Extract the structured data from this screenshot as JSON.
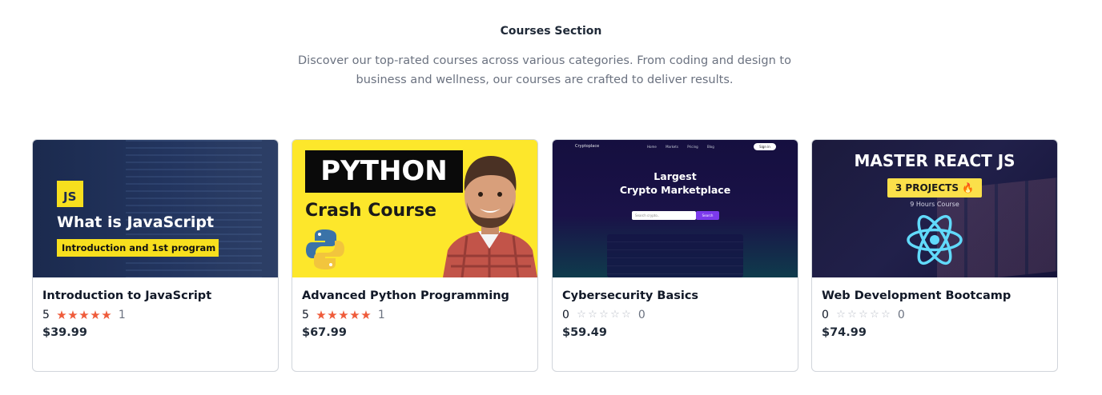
{
  "section": {
    "title": "Courses Section",
    "description": "Discover our top-rated courses across various categories. From coding and design to business and wellness, our courses are crafted to deliver results."
  },
  "colors": {
    "star_filled": "#ef5b3a",
    "star_empty": "#b9bec7",
    "card_border": "#d1d5db"
  },
  "courses": [
    {
      "title": "Introduction to JavaScript",
      "rating": "5",
      "stars_filled": 5,
      "rating_count": "1",
      "price": "$39.99",
      "thumb": {
        "badge": "JS",
        "headline": "What is JavaScript",
        "sub": "Introduction and 1st program"
      }
    },
    {
      "title": "Advanced Python Programming",
      "rating": "5",
      "stars_filled": 5,
      "rating_count": "1",
      "price": "$67.99",
      "thumb": {
        "headline": "PYTHON",
        "sub": "Crash Course"
      }
    },
    {
      "title": "Cybersecurity Basics",
      "rating": "0",
      "stars_filled": 0,
      "rating_count": "0",
      "price": "$59.49",
      "thumb": {
        "brand": "Cryptoplace",
        "nav": "Home Markets Pricing Blog",
        "signin": "Sign in",
        "headline_1": "Largest",
        "headline_2": "Crypto Marketplace",
        "search_placeholder": "Search crypto..",
        "search_button": "Search"
      }
    },
    {
      "title": "Web Development Bootcamp",
      "rating": "0",
      "stars_filled": 0,
      "rating_count": "0",
      "price": "$74.99",
      "thumb": {
        "headline": "MASTER REACT JS",
        "badge": "3 PROJECTS 🔥",
        "sub": "9 Hours Course"
      }
    }
  ]
}
